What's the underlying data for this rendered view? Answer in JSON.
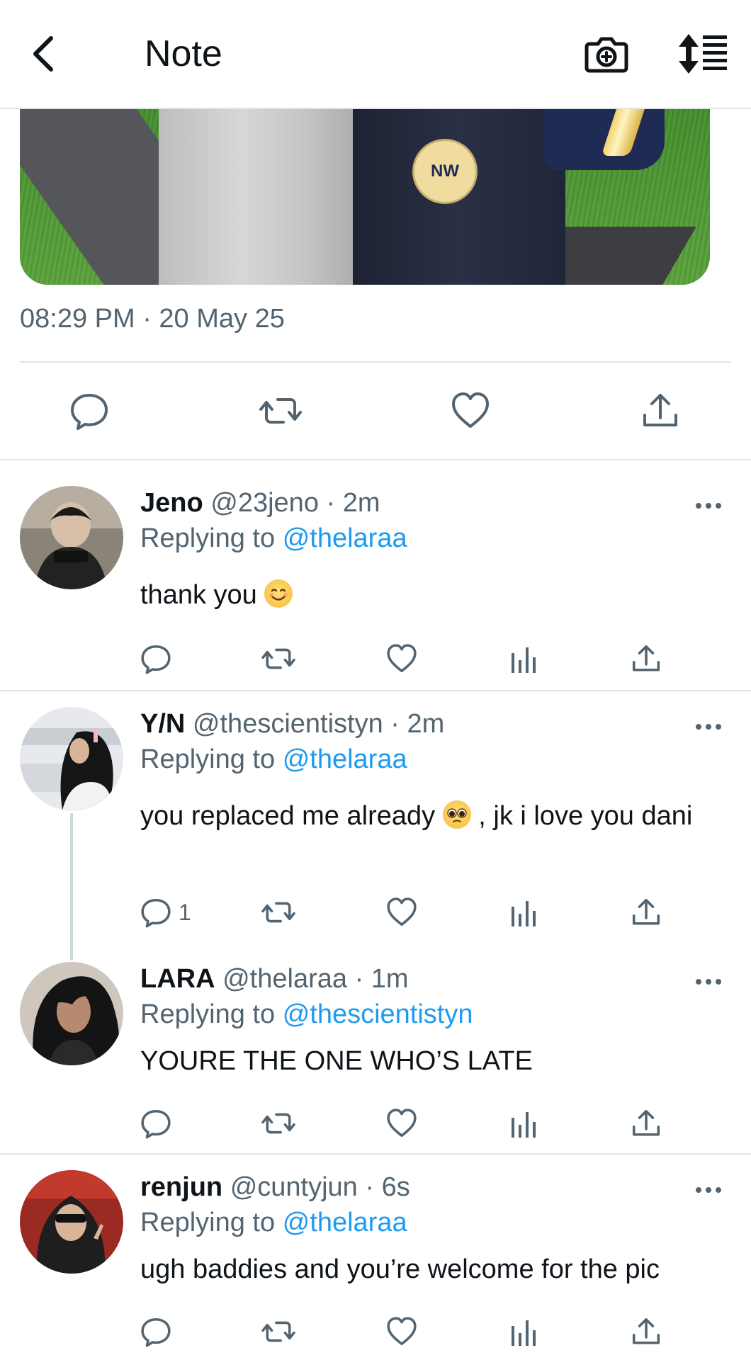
{
  "header": {
    "title": "Note",
    "back_icon": "chevron-left-icon",
    "camera_icon": "camera-add-icon",
    "sort_icon": "sort-list-icon"
  },
  "post": {
    "timestamp": "08:29 PM · 20 May 25",
    "patch_text": "NW"
  },
  "replies": [
    {
      "name": "Jeno",
      "handle": "@23jeno · 2m",
      "replying_prefix": "Replying to",
      "replying_to": "@thelaraa",
      "text": "thank you",
      "emoji": "smiling-face-emoji",
      "reply_count": ""
    },
    {
      "name": "Y/N",
      "handle": "@thescientistyn · 2m",
      "replying_prefix": "Replying to",
      "replying_to": "@thelaraa",
      "text_before_emoji": "you replaced me already",
      "text_after_emoji": ", jk i love you dani",
      "emoji": "pleading-face-emoji",
      "reply_count": "1"
    },
    {
      "name": "LARA",
      "handle": "@thelaraa · 1m",
      "replying_prefix": "Replying to",
      "replying_to": "@thescientistyn",
      "text": "YOURE THE ONE WHO’S LATE",
      "reply_count": ""
    },
    {
      "name": "renjun",
      "handle": "@cuntyjun · 6s",
      "replying_prefix": "Replying to",
      "replying_to": "@thelaraa",
      "text": "ugh baddies and you’re welcome for the pic",
      "reply_count": ""
    }
  ],
  "colors": {
    "accent": "#1d9bf0",
    "secondary_text": "#536471",
    "divider": "#e1e4e8"
  }
}
